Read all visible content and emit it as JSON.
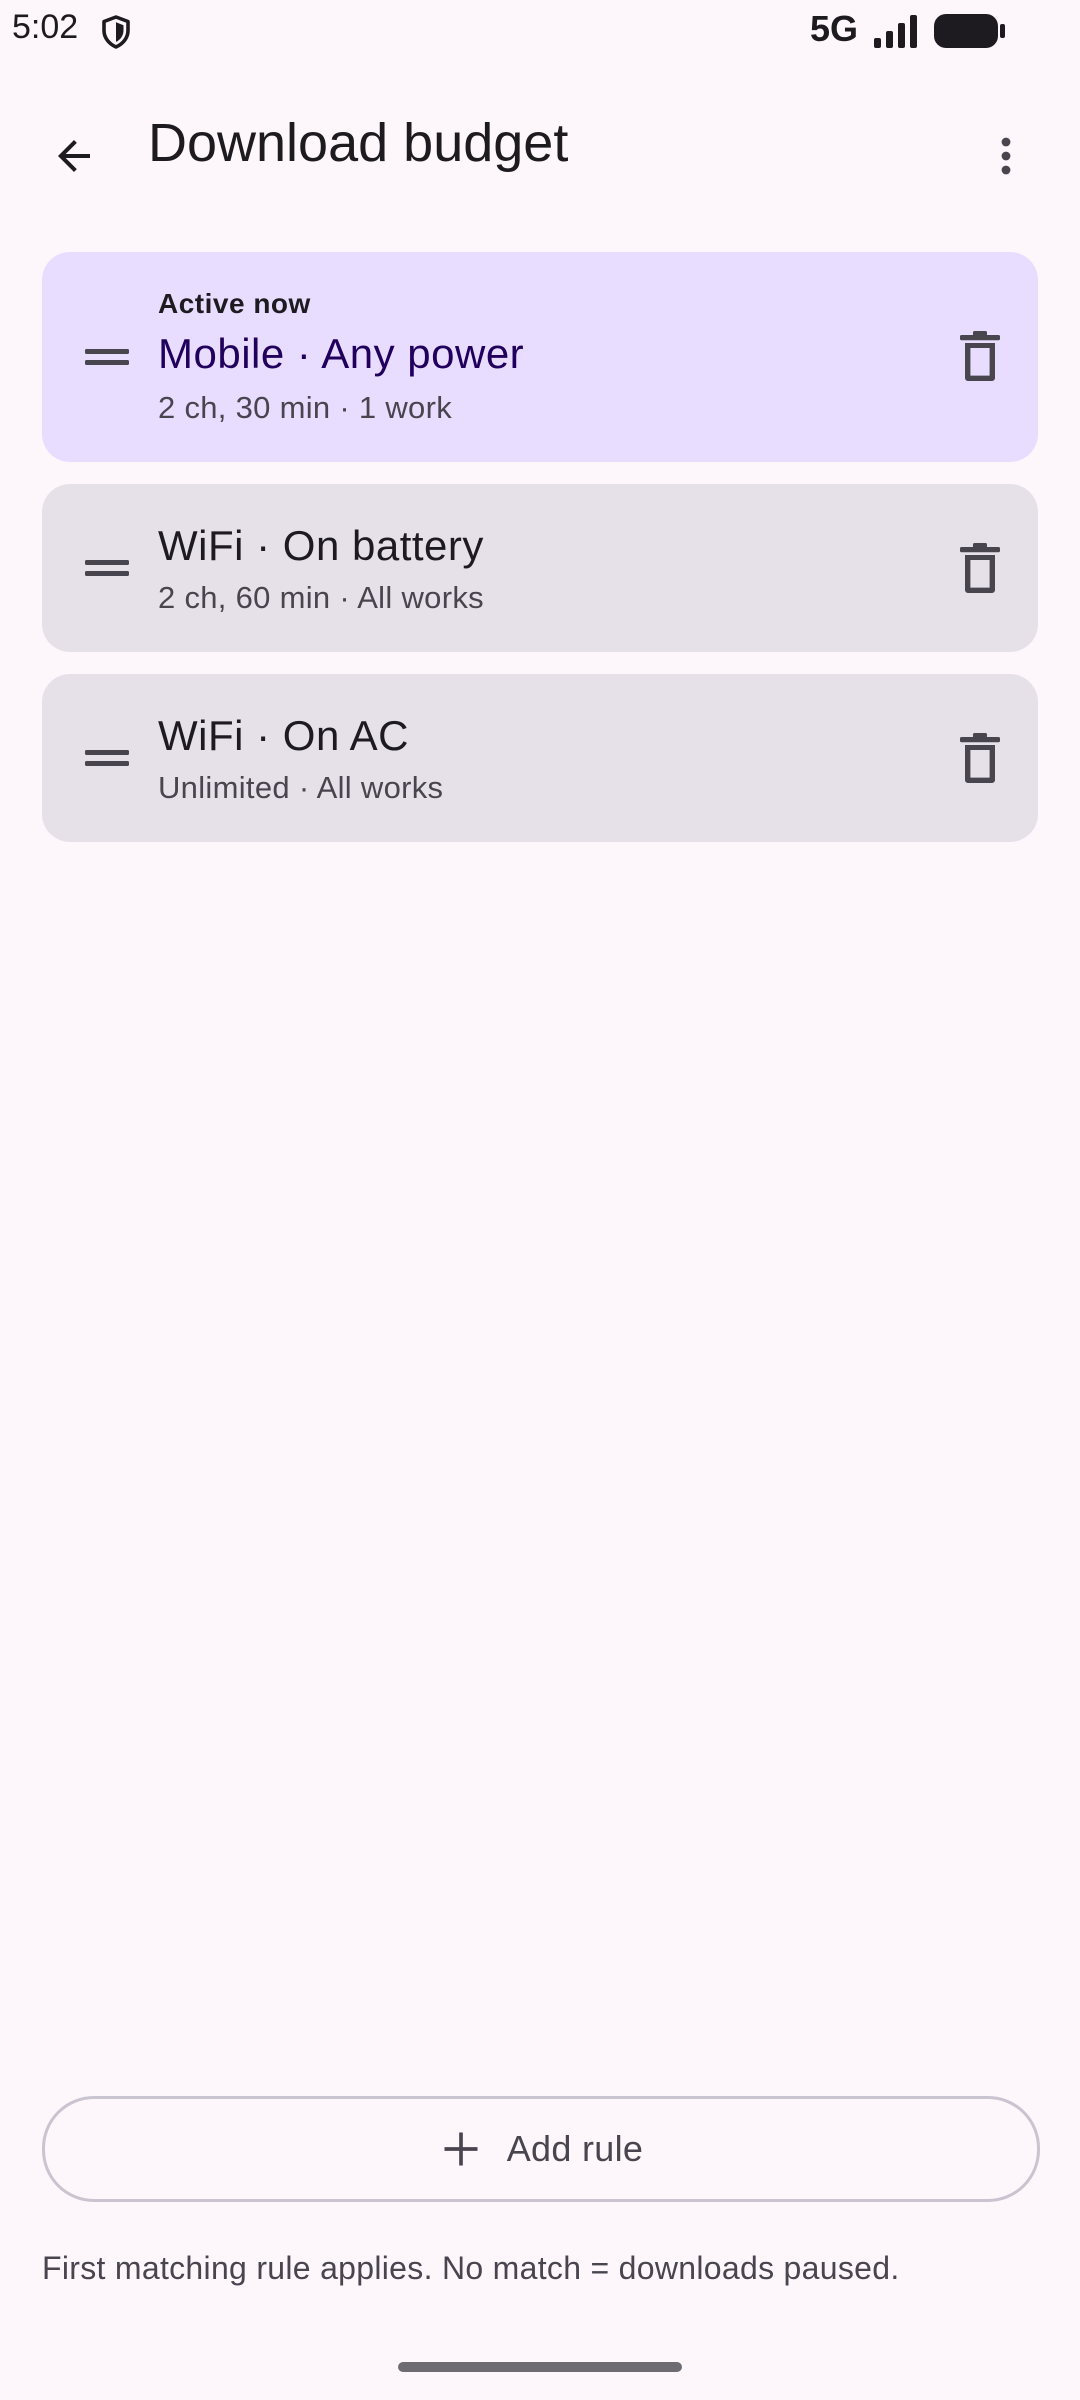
{
  "status_bar": {
    "time": "5:02",
    "network": "5G"
  },
  "app_bar": {
    "title": "Download budget"
  },
  "rules": [
    {
      "active_label": "Active now",
      "title": "Mobile · Any power",
      "subtitle": "2 ch, 30 min · 1 work",
      "active": true
    },
    {
      "title": "WiFi · On battery",
      "subtitle": "2 ch, 60 min · All works",
      "active": false
    },
    {
      "title": "WiFi · On AC",
      "subtitle": "Unlimited · All works",
      "active": false
    }
  ],
  "actions": {
    "add_rule_label": "Add rule"
  },
  "footer": {
    "note": "First matching rule applies. No match = downloads paused."
  },
  "icons": {
    "back": "arrow-back-icon",
    "more": "more-vert-icon",
    "drag": "drag-handle-icon",
    "delete": "trash-icon",
    "add": "plus-icon",
    "shield": "shield-icon",
    "signal": "signal-icon",
    "battery": "battery-icon"
  },
  "colors": {
    "background": "#fdf7fc",
    "active_card": "#e8ddff",
    "inactive_card": "#e6e0e9",
    "active_title": "#21005d",
    "outline": "#cac4d0"
  }
}
